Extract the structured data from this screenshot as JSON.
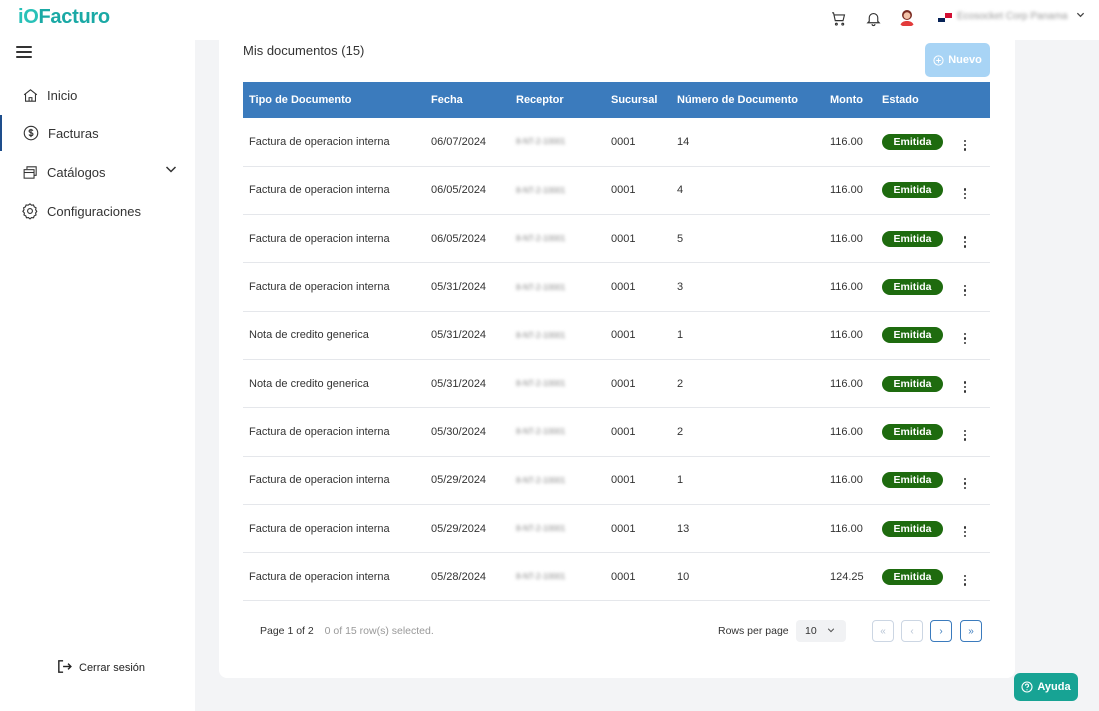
{
  "app": {
    "logo_prefix": "iO",
    "logo_text": "Facturo",
    "company_name": "Ecosocket Corp Panama"
  },
  "sidebar": {
    "items": [
      {
        "label": "Inicio",
        "icon": "home-icon"
      },
      {
        "label": "Facturas",
        "icon": "dollar-circle-icon"
      },
      {
        "label": "Catálogos",
        "icon": "folders-icon"
      },
      {
        "label": "Configuraciones",
        "icon": "gear-icon"
      }
    ],
    "logout_label": "Cerrar sesión"
  },
  "main": {
    "title": "Mis documentos (15)",
    "new_button": "Nuevo",
    "columns": [
      "Tipo de Documento",
      "Fecha",
      "Receptor",
      "Sucursal",
      "Número de Documento",
      "Monto",
      "Estado"
    ],
    "rows": [
      {
        "tipo": "Factura de operacion interna",
        "fecha": "06/07/2024",
        "receptor": "8-NT-2-10001",
        "sucursal": "0001",
        "numero": "14",
        "monto": "116.00",
        "estado": "Emitida"
      },
      {
        "tipo": "Factura de operacion interna",
        "fecha": "06/05/2024",
        "receptor": "8-NT-2-10001",
        "sucursal": "0001",
        "numero": "4",
        "monto": "116.00",
        "estado": "Emitida"
      },
      {
        "tipo": "Factura de operacion interna",
        "fecha": "06/05/2024",
        "receptor": "8-NT-2-10001",
        "sucursal": "0001",
        "numero": "5",
        "monto": "116.00",
        "estado": "Emitida"
      },
      {
        "tipo": "Factura de operacion interna",
        "fecha": "05/31/2024",
        "receptor": "8-NT-2-10001",
        "sucursal": "0001",
        "numero": "3",
        "monto": "116.00",
        "estado": "Emitida"
      },
      {
        "tipo": "Nota de credito generica",
        "fecha": "05/31/2024",
        "receptor": "8-NT-2-10001",
        "sucursal": "0001",
        "numero": "1",
        "monto": "116.00",
        "estado": "Emitida"
      },
      {
        "tipo": "Nota de credito generica",
        "fecha": "05/31/2024",
        "receptor": "8-NT-2-10001",
        "sucursal": "0001",
        "numero": "2",
        "monto": "116.00",
        "estado": "Emitida"
      },
      {
        "tipo": "Factura de operacion interna",
        "fecha": "05/30/2024",
        "receptor": "8-NT-2-10001",
        "sucursal": "0001",
        "numero": "2",
        "monto": "116.00",
        "estado": "Emitida"
      },
      {
        "tipo": "Factura de operacion interna",
        "fecha": "05/29/2024",
        "receptor": "8-NT-2-10001",
        "sucursal": "0001",
        "numero": "1",
        "monto": "116.00",
        "estado": "Emitida"
      },
      {
        "tipo": "Factura de operacion interna",
        "fecha": "05/29/2024",
        "receptor": "8-NT-2-10001",
        "sucursal": "0001",
        "numero": "13",
        "monto": "116.00",
        "estado": "Emitida"
      },
      {
        "tipo": "Factura de operacion interna",
        "fecha": "05/28/2024",
        "receptor": "8-NT-2-10001",
        "sucursal": "0001",
        "numero": "10",
        "monto": "124.25",
        "estado": "Emitida"
      }
    ]
  },
  "pagination": {
    "page_label": "Page 1 of 2",
    "selected_label": "0 of 15 row(s) selected.",
    "rows_per_page_label": "Rows per page",
    "rows_per_page_value": "10",
    "first": "«",
    "prev": "‹",
    "next": "›",
    "last": "»"
  },
  "help_button": "Ayuda",
  "colors": {
    "brand": "#1aa9a5",
    "header": "#3b7bbd",
    "status_emitida": "#1e6b0f",
    "new_button": "#a8d4f5",
    "help": "#17a394"
  }
}
